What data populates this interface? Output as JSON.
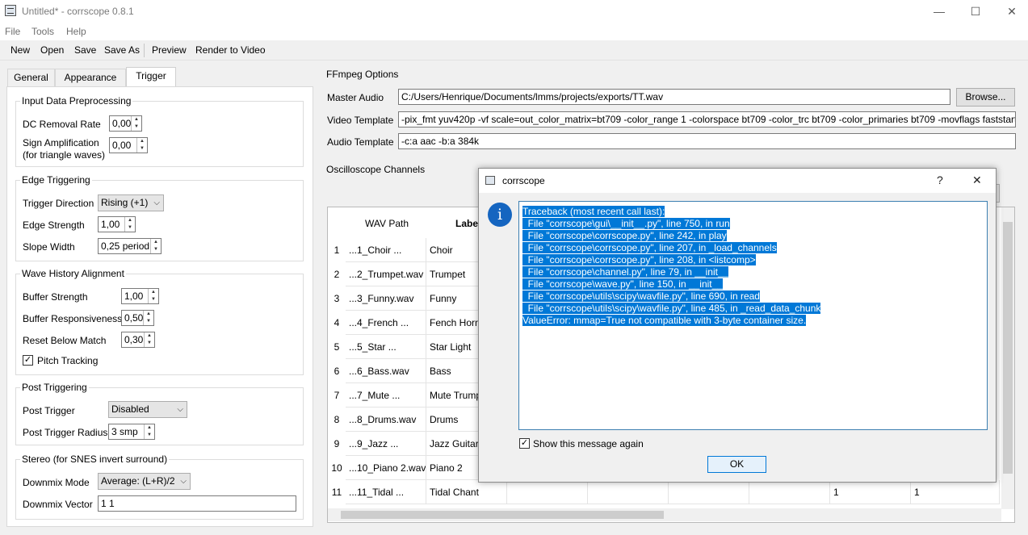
{
  "window": {
    "title": "Untitled* - corrscope 0.8.1",
    "minimize_glyph": "—",
    "maximize_glyph": "☐",
    "close_glyph": "✕"
  },
  "menu": [
    "File",
    "Tools",
    "Help"
  ],
  "toolbar": {
    "new": "New",
    "open": "Open",
    "save": "Save",
    "save_as": "Save As",
    "preview": "Preview",
    "render": "Render to Video"
  },
  "tabs": [
    "General",
    "Appearance",
    "Trigger"
  ],
  "trigger": {
    "input": {
      "title": "Input Data Preprocessing",
      "dc_label": "DC Removal Rate",
      "dc_value": "0,00",
      "sign_label_1": "Sign Amplification",
      "sign_label_2": "(for triangle waves)",
      "sign_value": "0,00"
    },
    "edge": {
      "title": "Edge Triggering",
      "dir_label": "Trigger Direction",
      "dir_value": "Rising (+1)",
      "strength_label": "Edge Strength",
      "strength_value": "1,00",
      "slope_label": "Slope Width",
      "slope_value": "0,25 period"
    },
    "wave": {
      "title": "Wave History Alignment",
      "buf_label": "Buffer Strength",
      "buf_value": "1,00",
      "resp_label": "Buffer Responsiveness",
      "resp_value": "0,50",
      "reset_label": "Reset Below Match",
      "reset_value": "0,30",
      "pitch_label": "Pitch Tracking",
      "pitch_checked": "✓"
    },
    "post": {
      "title": "Post Triggering",
      "post_label": "Post Trigger",
      "post_value": "Disabled",
      "radius_label": "Post Trigger Radius",
      "radius_value": "3 smp"
    },
    "stereo": {
      "title": "Stereo (for SNES invert surround)",
      "mode_label": "Downmix Mode",
      "mode_value": "Average: (L+R)/2",
      "vector_label": "Downmix Vector",
      "vector_value": "1 1"
    }
  },
  "ffmpeg": {
    "title": "FFmpeg Options",
    "audio_label": "Master Audio",
    "audio_value": "C:/Users/Henrique/Documents/lmms/projects/exports/TT.wav",
    "browse": "Browse...",
    "video_label": "Video Template",
    "video_value": "-pix_fmt yuv420p -vf scale=out_color_matrix=bt709 -color_range 1 -colorspace bt709 -color_trc bt709 -color_primaries bt709 -movflags faststart",
    "atemplate_label": "Audio Template",
    "atemplate_value": "-c:a aac -b:a 384k"
  },
  "channels": {
    "title": "Oscilloscope Channels",
    "headers": {
      "wav": "WAV Path",
      "label": "Label"
    },
    "rows": [
      {
        "num": "1",
        "wav": "...1_Choir ...",
        "label": "Choir"
      },
      {
        "num": "2",
        "wav": "...2_Trumpet.wav",
        "label": "Trumpet"
      },
      {
        "num": "3",
        "wav": "...3_Funny.wav",
        "label": "Funny"
      },
      {
        "num": "4",
        "wav": "...4_French ...",
        "label": "Fench Horn"
      },
      {
        "num": "5",
        "wav": "...5_Star ...",
        "label": "Star Light"
      },
      {
        "num": "6",
        "wav": "...6_Bass.wav",
        "label": "Bass"
      },
      {
        "num": "7",
        "wav": "...7_Mute ...",
        "label": "Mute Trump"
      },
      {
        "num": "8",
        "wav": "...8_Drums.wav",
        "label": "Drums"
      },
      {
        "num": "9",
        "wav": "...9_Jazz ...",
        "label": "Jazz Guitar"
      },
      {
        "num": "10",
        "wav": "...10_Piano 2.wav",
        "label": " Piano 2"
      },
      {
        "num": "11",
        "wav": "...11_Tidal ...",
        "label": "Tidal Chant",
        "extra1": "1",
        "extra2": "1"
      }
    ]
  },
  "dialog": {
    "title": "corrscope",
    "help": "?",
    "close": "✕",
    "icon": "i",
    "traceback": [
      "Traceback (most recent call last):",
      "  File \"corrscope\\gui\\__init__.py\", line 750, in run",
      "  File \"corrscope\\corrscope.py\", line 242, in play",
      "  File \"corrscope\\corrscope.py\", line 207, in _load_channels",
      "  File \"corrscope\\corrscope.py\", line 208, in <listcomp>",
      "  File \"corrscope\\channel.py\", line 79, in __init__",
      "  File \"corrscope\\wave.py\", line 150, in __init__",
      "  File \"corrscope\\utils\\scipy\\wavfile.py\", line 690, in read",
      "  File \"corrscope\\utils\\scipy\\wavfile.py\", line 485, in _read_data_chunk",
      "ValueError: mmap=True not compatible with 3-byte container size."
    ],
    "show_again": "Show this message again",
    "show_again_checked": "✓",
    "ok": "OK"
  },
  "colors": {
    "accent": "#0078d7",
    "info_icon": "#1565c0"
  }
}
